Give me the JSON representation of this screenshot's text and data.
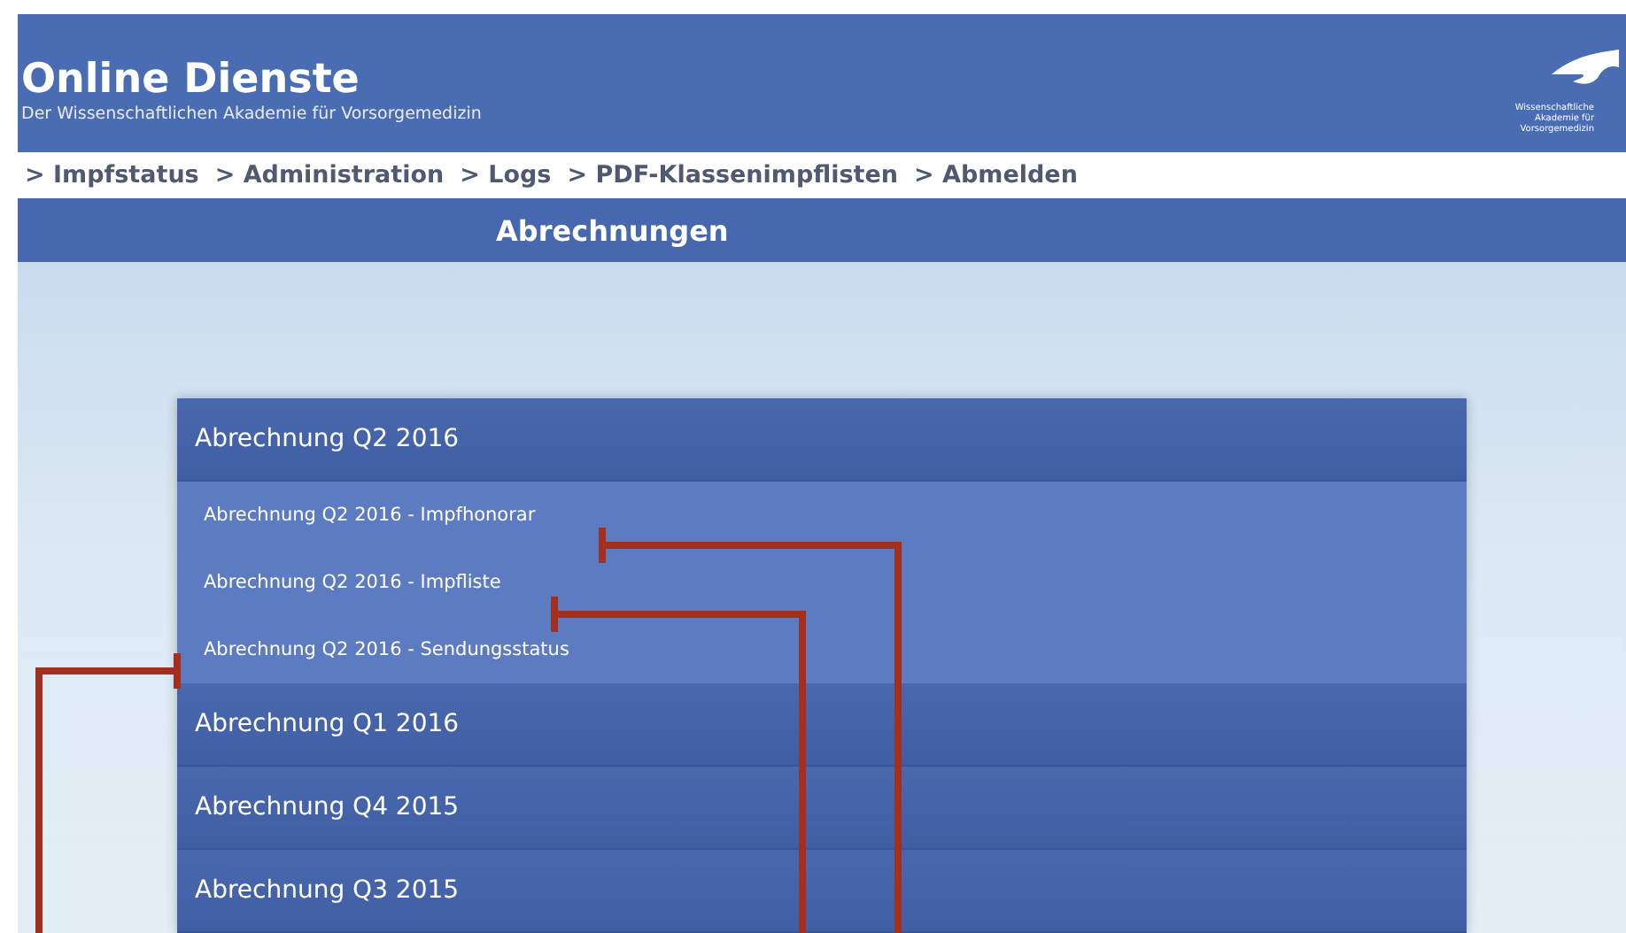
{
  "header": {
    "title": "Online Dienste",
    "subtitle": "Der Wissenschaftlichen Akademie für Vorsorgemedizin",
    "logo_text": [
      "Wissenschaftliche",
      "Akademie für",
      "Vorsorgemedizin"
    ]
  },
  "nav": [
    {
      "label": "> Impfstatus"
    },
    {
      "label": "> Administration"
    },
    {
      "label": "> Logs"
    },
    {
      "label": "> PDF-Klassenimpflisten"
    },
    {
      "label": "> Abmelden"
    }
  ],
  "page_title": "Abrechnungen",
  "sections": [
    {
      "label": "Abrechnung Q2 2016",
      "expanded": true,
      "children": [
        "Abrechnung Q2 2016 - Impfhonorar",
        "Abrechnung Q2 2016 - Impfliste",
        "Abrechnung Q2 2016 - Sendungsstatus"
      ]
    },
    {
      "label": "Abrechnung Q1 2016",
      "expanded": false
    },
    {
      "label": "Abrechnung Q4 2015",
      "expanded": false
    },
    {
      "label": "Abrechnung Q3 2015",
      "expanded": false
    }
  ]
}
